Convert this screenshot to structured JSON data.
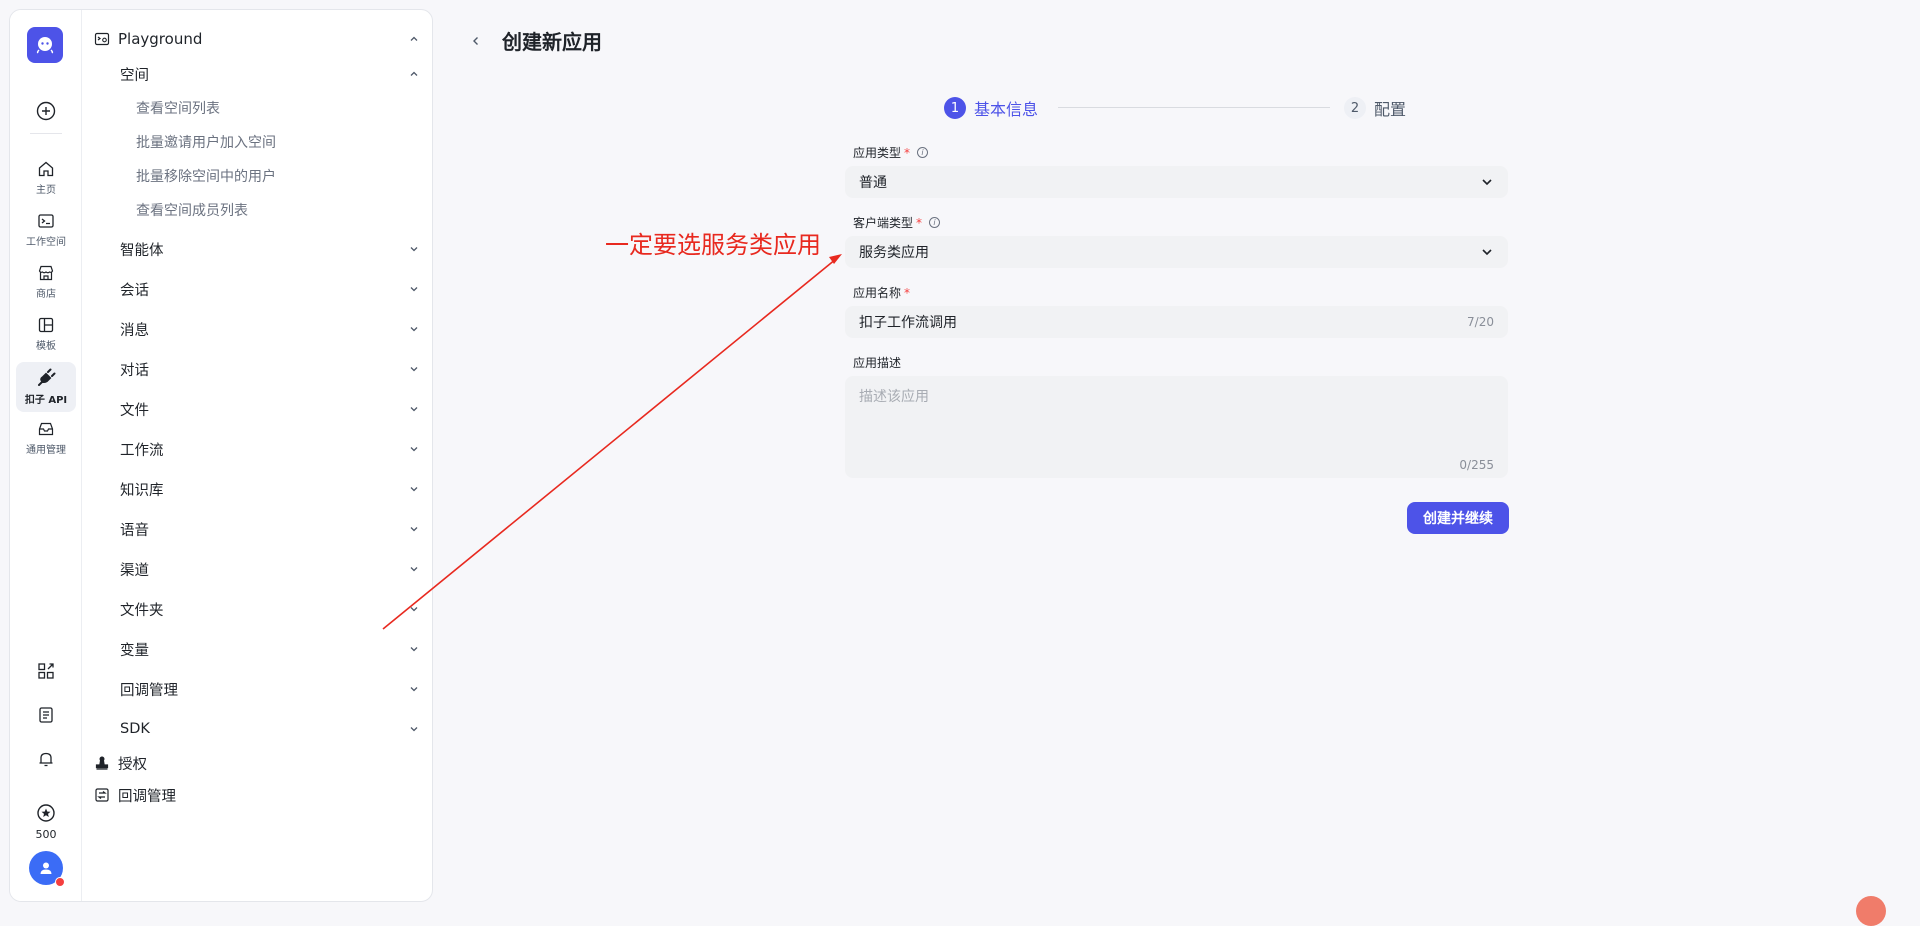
{
  "rail": {
    "items": [
      {
        "label": "主页",
        "icon": "home-icon"
      },
      {
        "label": "工作空间",
        "icon": "terminal-icon"
      },
      {
        "label": "商店",
        "icon": "store-icon"
      },
      {
        "label": "模板",
        "icon": "template-icon"
      },
      {
        "label": "扣子 API",
        "icon": "plug-icon"
      },
      {
        "label": "通用管理",
        "icon": "inbox-icon"
      }
    ],
    "credits": "500"
  },
  "nav": {
    "header": "Playground",
    "space_group": "空间",
    "space_items": [
      "查看空间列表",
      "批量邀请用户加入空间",
      "批量移除空间中的用户",
      "查看空间成员列表"
    ],
    "groups": [
      "智能体",
      "会话",
      "消息",
      "对话",
      "文件",
      "工作流",
      "知识库",
      "语音",
      "渠道",
      "文件夹",
      "变量",
      "回调管理",
      "SDK"
    ],
    "bottom_items": [
      "授权",
      "回调管理"
    ]
  },
  "page": {
    "title": "创建新应用",
    "steps": [
      {
        "num": "1",
        "label": "基本信息"
      },
      {
        "num": "2",
        "label": "配置"
      }
    ]
  },
  "form": {
    "app_type_label": "应用类型",
    "app_type_value": "普通",
    "client_type_label": "客户端类型",
    "client_type_value": "服务类应用",
    "name_label": "应用名称",
    "name_value": "扣子工作流调用",
    "name_count": "7/20",
    "desc_label": "应用描述",
    "desc_placeholder": "描述该应用",
    "desc_count": "0/255",
    "required_mark": "*",
    "submit_label": "创建并继续"
  },
  "annotation": {
    "text": "一定要选服务类应用",
    "color": "#e8291f"
  },
  "colors": {
    "accent": "#4d53e8"
  }
}
